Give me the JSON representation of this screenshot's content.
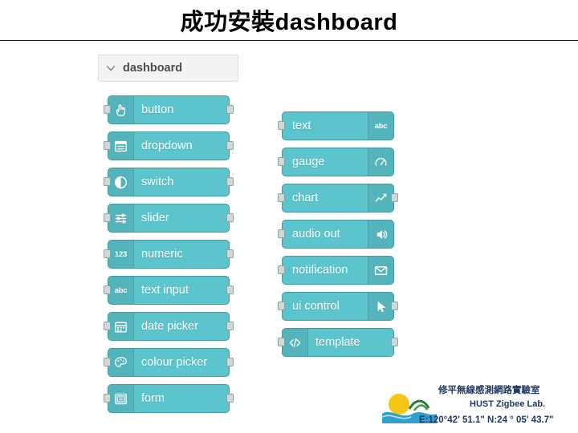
{
  "slide": {
    "title": "成功安裝dashboard"
  },
  "palette": {
    "category_label": "dashboard",
    "collapse_icon": "chevron-down-icon"
  },
  "nodes_left": [
    {
      "label": "button",
      "icon": "hand-pointer-icon",
      "icon_side": "left",
      "has_input": true,
      "has_output": true
    },
    {
      "label": "dropdown",
      "icon": "list-box-icon",
      "icon_side": "left",
      "has_input": true,
      "has_output": true
    },
    {
      "label": "switch",
      "icon": "toggle-circle-icon",
      "icon_side": "left",
      "has_input": true,
      "has_output": true
    },
    {
      "label": "slider",
      "icon": "sliders-icon",
      "icon_side": "left",
      "has_input": true,
      "has_output": true
    },
    {
      "label": "numeric",
      "icon": "123-icon",
      "icon_side": "left",
      "has_input": true,
      "has_output": true
    },
    {
      "label": "text input",
      "icon": "abc-icon",
      "icon_side": "left",
      "has_input": true,
      "has_output": true
    },
    {
      "label": "date picker",
      "icon": "calendar-icon",
      "icon_side": "left",
      "has_input": true,
      "has_output": true
    },
    {
      "label": "colour picker",
      "icon": "palette-icon",
      "icon_side": "left",
      "has_input": true,
      "has_output": true
    },
    {
      "label": "form",
      "icon": "form-icon",
      "icon_side": "left",
      "has_input": true,
      "has_output": true
    }
  ],
  "nodes_right": [
    {
      "label": "text",
      "icon": "abc-icon",
      "icon_side": "right",
      "has_input": true,
      "has_output": false
    },
    {
      "label": "gauge",
      "icon": "gauge-icon",
      "icon_side": "right",
      "has_input": true,
      "has_output": false
    },
    {
      "label": "chart",
      "icon": "line-chart-icon",
      "icon_side": "right",
      "has_input": true,
      "has_output": true
    },
    {
      "label": "audio out",
      "icon": "speaker-icon",
      "icon_side": "right",
      "has_input": true,
      "has_output": false
    },
    {
      "label": "notification",
      "icon": "envelope-icon",
      "icon_side": "right",
      "has_input": true,
      "has_output": false
    },
    {
      "label": "ui control",
      "icon": "cursor-icon",
      "icon_side": "right",
      "has_input": true,
      "has_output": true
    },
    {
      "label": "template",
      "icon": "code-icon",
      "icon_side": "left",
      "has_input": true,
      "has_output": true
    }
  ],
  "footer": {
    "lab_name_zh": "修平無線感測網路實驗室",
    "lab_name_en": "HUST Zigbee Lab.",
    "coordinates": "E:120°42' 51.1\"  N:24 ° 05' 43.7\"",
    "emblem": "sunrise-over-water-icon"
  },
  "colors": {
    "node_fill": "#5bc4cd",
    "node_border": "#3f9aa3",
    "palette_header_bg": "#f3f3f3",
    "footer_text": "#1f3864",
    "title_text": "#000000"
  }
}
